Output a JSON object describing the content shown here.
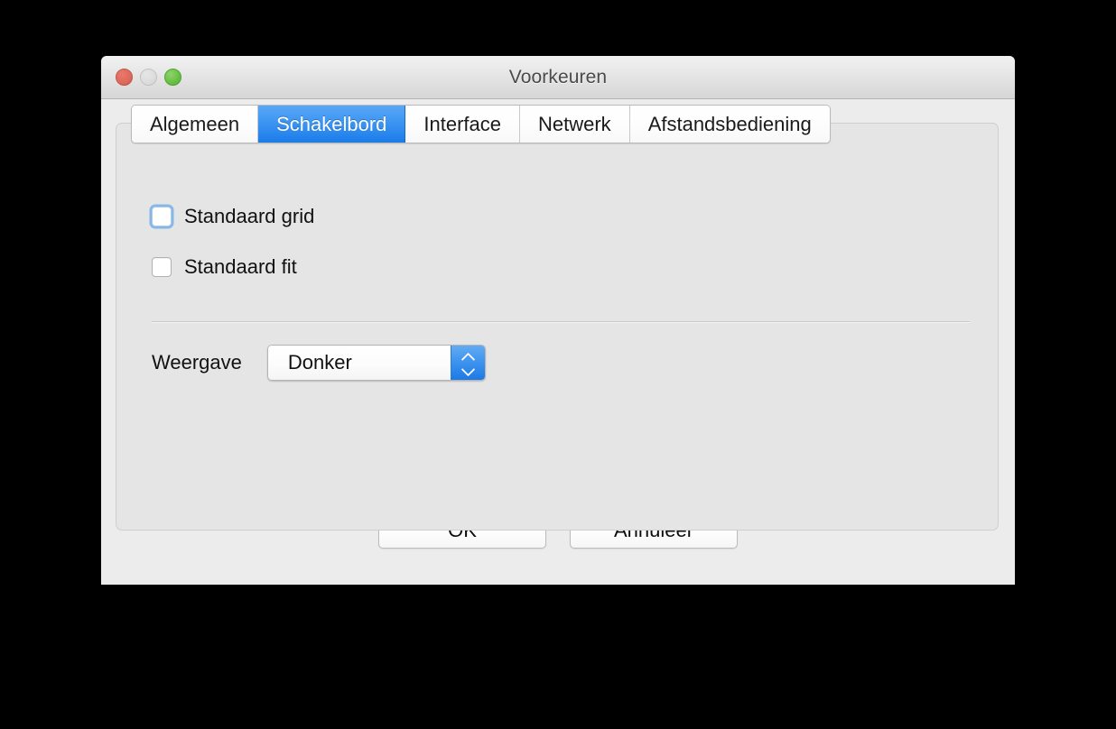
{
  "window": {
    "title": "Voorkeuren",
    "traffic_lights": [
      {
        "name": "close",
        "color": "#dd6a5b"
      },
      {
        "name": "minimize",
        "color": "#dcdcdc"
      },
      {
        "name": "zoom",
        "color": "#67bf44"
      }
    ]
  },
  "tabs": [
    {
      "label": "Algemeen",
      "selected": false
    },
    {
      "label": "Schakelbord",
      "selected": true
    },
    {
      "label": "Interface",
      "selected": false
    },
    {
      "label": "Netwerk",
      "selected": false
    },
    {
      "label": "Afstandsbediening",
      "selected": false
    }
  ],
  "panel": {
    "checkboxes": [
      {
        "label": "Standaard grid",
        "checked": false,
        "focused": true
      },
      {
        "label": "Standaard fit",
        "checked": false,
        "focused": false
      }
    ],
    "popup": {
      "label": "Weergave",
      "value": "Donker",
      "options": [
        "Donker"
      ]
    }
  },
  "buttons": {
    "ok": "OK",
    "cancel": "Annuleer"
  },
  "colors": {
    "accent_blue": "#1d7ae4",
    "selected_tab_blue": "#3d95f2",
    "focus_ring": "#68a6e7",
    "window_background": "#ececec",
    "panel_background": "#e5e5e5",
    "desktop_background": "#000000"
  }
}
